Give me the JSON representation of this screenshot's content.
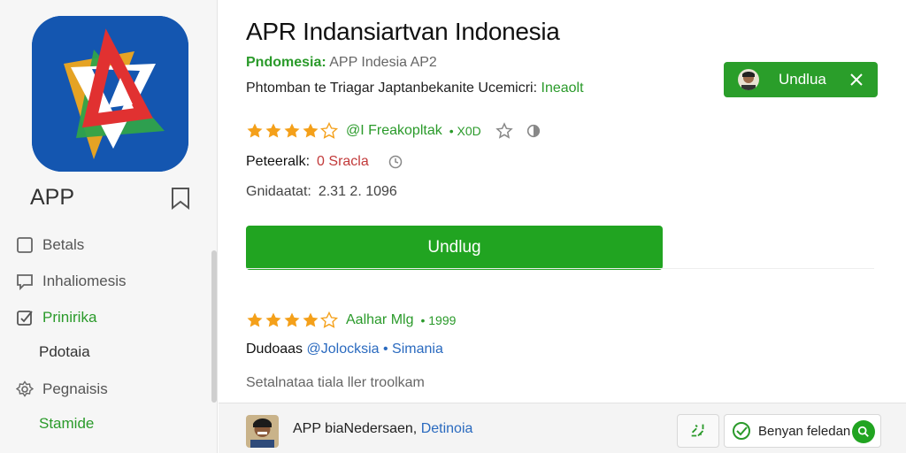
{
  "sidebar": {
    "app_name": "APP",
    "items": [
      {
        "label": "Betals",
        "icon": "square-icon"
      },
      {
        "label": "Inhaliomesis",
        "icon": "comment-icon"
      },
      {
        "label": "Prinirika",
        "icon": "edit-icon"
      },
      {
        "label": "Pdotaia",
        "icon": ""
      },
      {
        "label": "Pegnaisis",
        "icon": "settings-icon"
      },
      {
        "label": "Stamide",
        "icon": ""
      }
    ]
  },
  "main": {
    "title": "APR Indansiartvan Indonesia",
    "sub_green": "Pndomesia:",
    "sub_text": "APP Indesia AP2",
    "desc_text": "Phtomban te Triagar Japtanbekanite Ucemicri:",
    "desc_green": "Ineaolt",
    "rating1_text": "@I Freakopltak",
    "rating1_count": "• X0D",
    "rating1_stars": 4,
    "meta1_label": "Peteeralk:",
    "meta1_value": "0 Sracla",
    "meta2_label": "Gnidaatat:",
    "meta2_value": "2.31 2. 1096",
    "install_label": "Undlug",
    "rating2_text": "Aalhar Mlg",
    "rating2_count": "• 1999",
    "rating2_stars": 4,
    "dev_label": "Dudoaas",
    "dev_value": "@Jolocksia • Simania",
    "note": "Setalnataa tiala ller troolkam"
  },
  "toast": {
    "label": "Undlua"
  },
  "bottombar": {
    "text": "APP biaNedersaen,",
    "text_blue": "Detinoia",
    "button_label": "Benyan feledan"
  },
  "colors": {
    "accent_green": "#21a421",
    "link_blue": "#2a6abf",
    "star_orange": "#f4a01a",
    "sidebar_bg": "#f6f6f6"
  }
}
